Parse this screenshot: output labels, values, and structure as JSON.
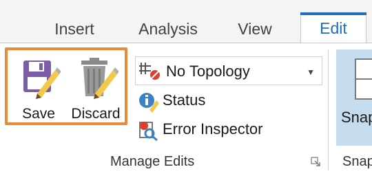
{
  "tabs": [
    {
      "label": "Insert"
    },
    {
      "label": "Analysis"
    },
    {
      "label": "View"
    },
    {
      "label": "Edit",
      "active": true
    }
  ],
  "manage_edits": {
    "save_label": "Save",
    "discard_label": "Discard",
    "topology_dropdown": {
      "selected": "No Topology"
    },
    "status_label": "Status",
    "error_inspector_label": "Error Inspector",
    "group_label": "Manage Edits"
  },
  "snapping": {
    "button_label": "Snap",
    "group_label": "Snap"
  },
  "colors": {
    "accent": "#1d6fba",
    "highlight_box": "#ec8a3b",
    "save_icon": "#7b5ea7",
    "pencil": "#f2c94c"
  }
}
